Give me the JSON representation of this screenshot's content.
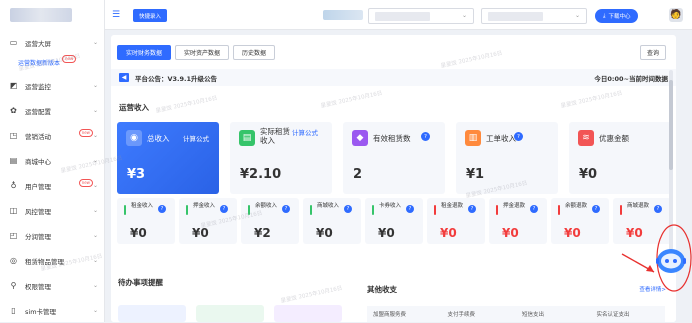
{
  "sidebar": {
    "items": [
      {
        "label": "运营大屏",
        "icon": "monitor-icon",
        "badge": ""
      },
      {
        "label": "运营监控",
        "icon": "chart-icon",
        "badge": ""
      },
      {
        "label": "运营配置",
        "icon": "gear-icon",
        "badge": ""
      },
      {
        "label": "营销活动",
        "icon": "megaphone-icon",
        "badge": "new"
      },
      {
        "label": "商城中心",
        "icon": "store-icon",
        "badge": ""
      },
      {
        "label": "用户管理",
        "icon": "user-icon",
        "badge": "new"
      },
      {
        "label": "风控管理",
        "icon": "shield-icon",
        "badge": ""
      },
      {
        "label": "分润管理",
        "icon": "share-icon",
        "badge": ""
      },
      {
        "label": "租赁物品管理",
        "icon": "box-icon",
        "badge": ""
      },
      {
        "label": "权限管理",
        "icon": "lock-icon",
        "badge": ""
      },
      {
        "label": "sim卡管理",
        "icon": "sim-icon",
        "badge": ""
      }
    ],
    "sub_item": {
      "label": "运营数据新版本",
      "badge": "new"
    }
  },
  "header": {
    "quick_entry_label": "快捷录入",
    "download_center_label": "下载中心"
  },
  "main": {
    "tabs": [
      {
        "label": "实时财务数据",
        "active": true
      },
      {
        "label": "实时资产数据",
        "active": false
      },
      {
        "label": "历史数据",
        "active": false
      }
    ],
    "query_label": "查询",
    "notice": {
      "text": "平台公告：V3.9.1升级公告",
      "right": "今日0:00~当前时间数据"
    },
    "section_title": "运营收入",
    "cards": [
      {
        "name": "总收入",
        "link": "计算公式",
        "value": "¥3",
        "icon": "coins-icon",
        "color": "#3e7bff"
      },
      {
        "name": "实际租赁收入",
        "link": "计算公式",
        "value": "¥2.10",
        "icon": "receipt-icon",
        "color": "#36c46a"
      },
      {
        "name": "有效租赁数",
        "link": "",
        "value": "2",
        "icon": "bag-icon",
        "color": "#9b59f0"
      },
      {
        "name": "工单收入",
        "link": "",
        "value": "¥1",
        "icon": "document-icon",
        "color": "#ff8a3d"
      },
      {
        "name": "优惠金额",
        "link": "",
        "value": "¥0",
        "icon": "stack-icon",
        "color": "#f25555"
      }
    ],
    "mini_cards": [
      {
        "name": "租金收入",
        "value": "¥0",
        "red": false
      },
      {
        "name": "押金收入",
        "value": "¥0",
        "red": false
      },
      {
        "name": "余额收入",
        "value": "¥2",
        "red": false
      },
      {
        "name": "商城收入",
        "value": "¥0",
        "red": false
      },
      {
        "name": "卡券收入",
        "value": "¥0",
        "red": false
      },
      {
        "name": "租金退款",
        "value": "¥0",
        "red": true
      },
      {
        "name": "押金退款",
        "value": "¥0",
        "red": true
      },
      {
        "name": "余额退款",
        "value": "¥0",
        "red": true
      },
      {
        "name": "商城退款",
        "value": "¥0",
        "red": true
      }
    ]
  },
  "todo": {
    "title": "待办事项提醒"
  },
  "other": {
    "title": "其他收支",
    "link": "查看详情>",
    "columns": [
      "加盟商服务费",
      "支付手续费",
      "短信支出",
      "实名认证支出"
    ]
  },
  "watermark": "星星饭 2025年10月16日",
  "colors": {
    "accent": "#2f6bff",
    "refund": "#f23c3c"
  }
}
